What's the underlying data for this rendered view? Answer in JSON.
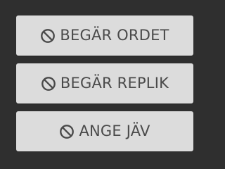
{
  "buttons": [
    {
      "label": "BEGÄR ORDET",
      "icon": "block-icon"
    },
    {
      "label": "BEGÄR REPLIK",
      "icon": "block-icon"
    },
    {
      "label": "ANGE JÄV",
      "icon": "block-icon"
    }
  ],
  "colors": {
    "background": "#2f2f2f",
    "button": "#dcdcdc",
    "text": "#4a4a4a"
  }
}
